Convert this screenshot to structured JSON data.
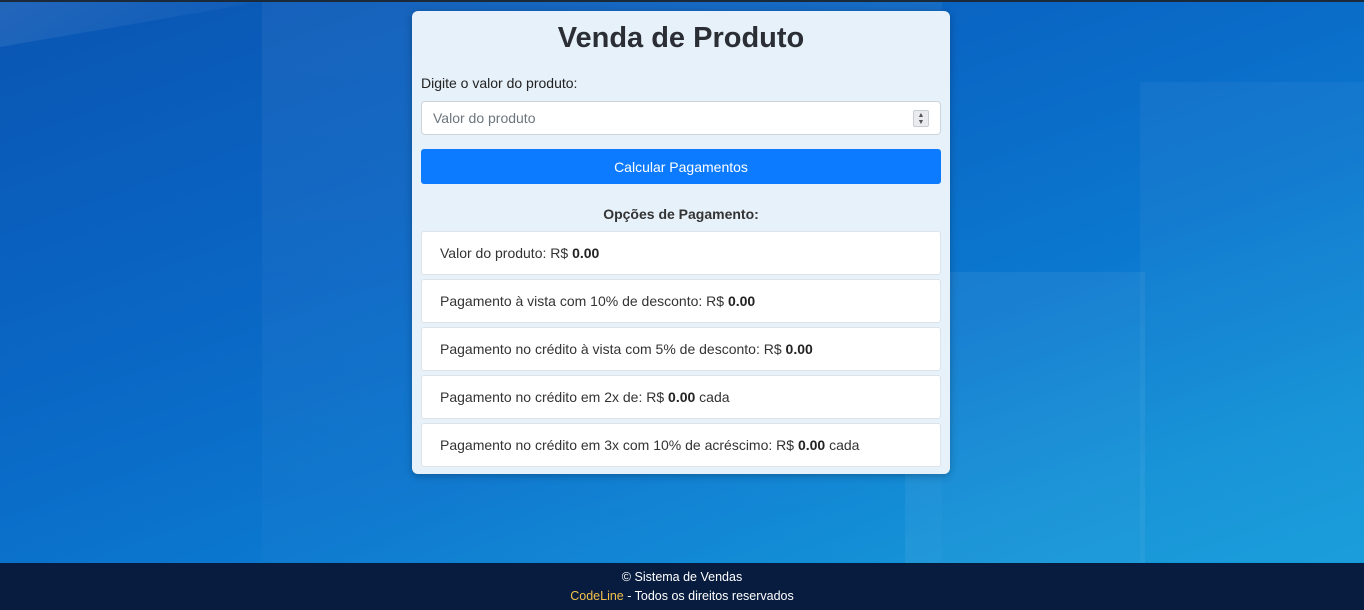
{
  "page": {
    "title": "Venda de Produto"
  },
  "form": {
    "label": "Digite o valor do produto:",
    "input_placeholder": "Valor do produto",
    "input_value": "",
    "button_label": "Calcular Pagamentos"
  },
  "options": {
    "title": "Opções de Pagamento:",
    "currency": "R$",
    "items": [
      {
        "prefix": "Valor do produto:",
        "amount": "0.00",
        "suffix": ""
      },
      {
        "prefix": "Pagamento à vista com 10% de desconto:",
        "amount": "0.00",
        "suffix": ""
      },
      {
        "prefix": "Pagamento no crédito à vista com 5% de desconto:",
        "amount": "0.00",
        "suffix": ""
      },
      {
        "prefix": "Pagamento no crédito em 2x de:",
        "amount": "0.00",
        "suffix": "cada"
      },
      {
        "prefix": "Pagamento no crédito em 3x com 10% de acréscimo:",
        "amount": "0.00",
        "suffix": "cada"
      }
    ]
  },
  "footer": {
    "line1": "© Sistema de Vendas",
    "brand": "CodeLine",
    "line2_rest": " - Todos os direitos reservados"
  },
  "colors": {
    "button": "#0d7bff",
    "footer_bg": "#081c3f",
    "brand": "#f3c14b"
  },
  "icons": {
    "input_spinner": "number-stepper-icon"
  }
}
